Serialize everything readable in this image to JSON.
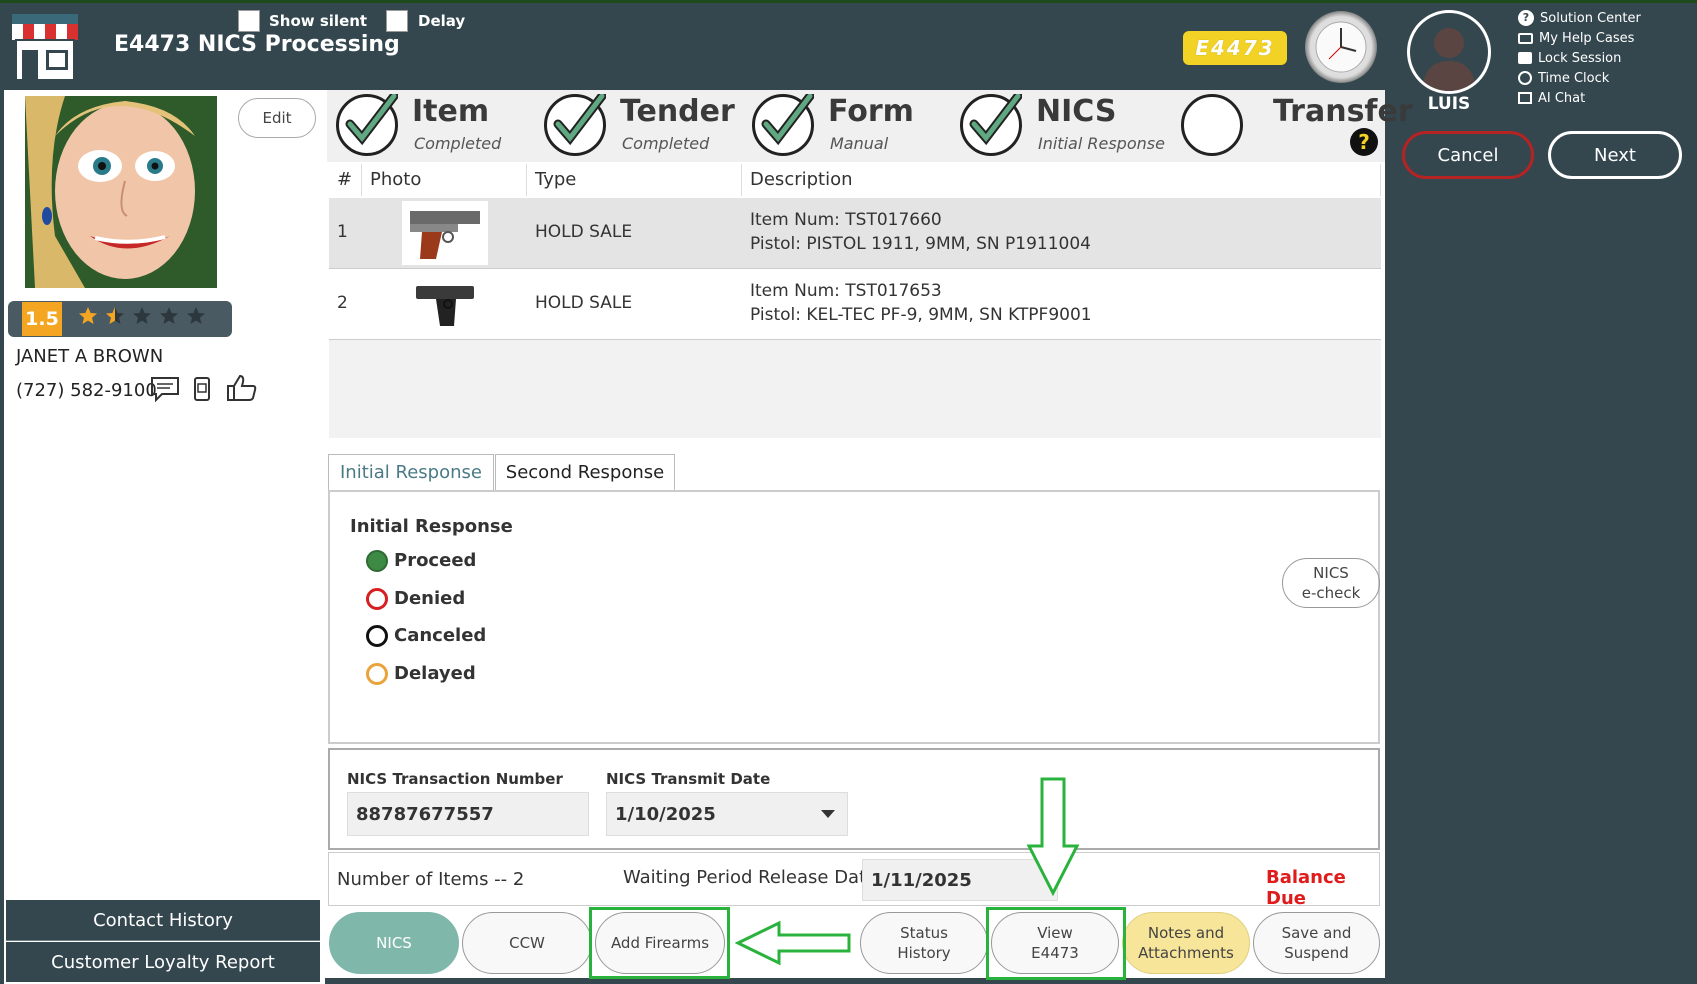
{
  "header": {
    "title": "E4473 NICS Processing",
    "show_silent_label": "Show silent",
    "delay_label": "Delay",
    "badge": "E4473"
  },
  "user": {
    "name": "LUIS",
    "menu": [
      "Solution Center",
      "My Help Cases",
      "Lock Session",
      "Time Clock",
      "AI Chat"
    ],
    "cancel_label": "Cancel",
    "next_label": "Next"
  },
  "steps": [
    {
      "title": "Item",
      "sub": "Completed",
      "done": true
    },
    {
      "title": "Tender",
      "sub": "Completed",
      "done": true
    },
    {
      "title": "Form",
      "sub": "Manual",
      "done": true
    },
    {
      "title": "NICS",
      "sub": "Initial Response",
      "done": true
    },
    {
      "title": "Transfer",
      "sub": "",
      "done": false
    }
  ],
  "table": {
    "headers": [
      "#",
      "Photo",
      "Type",
      "Description"
    ],
    "rows": [
      {
        "num": "1",
        "type": "HOLD SALE",
        "desc1": "Item Num: TST017660",
        "desc2": "Pistol: PISTOL 1911, 9MM, SN P1911004"
      },
      {
        "num": "2",
        "type": "HOLD SALE",
        "desc1": "Item Num: TST017653",
        "desc2": "Pistol: KEL-TEC PF-9, 9MM, SN KTPF9001"
      }
    ]
  },
  "tabs": [
    "Initial Response",
    "Second Response"
  ],
  "response": {
    "heading": "Initial Response",
    "options": [
      "Proceed",
      "Denied",
      "Canceled",
      "Delayed"
    ],
    "selected": "Proceed",
    "echeck_line1": "NICS",
    "echeck_line2": "e-check"
  },
  "nics": {
    "txn_label": "NICS Transaction Number",
    "txn_value": "88787677557",
    "date_label": "NICS Transmit Date",
    "date_value": "1/10/2025"
  },
  "info": {
    "items": "Number of Items -- 2",
    "waiting_label": "Waiting Period Release Date:",
    "waiting_value": "1/11/2025",
    "balance": "Balance Due"
  },
  "bottom_buttons": [
    {
      "l1": "NICS",
      "l2": ""
    },
    {
      "l1": "CCW",
      "l2": ""
    },
    {
      "l1": "Add Firearms",
      "l2": ""
    },
    {
      "l1": "Status",
      "l2": "History"
    },
    {
      "l1": "View",
      "l2": "E4473"
    },
    {
      "l1": "Notes and",
      "l2": "Attachments"
    },
    {
      "l1": "Save and",
      "l2": "Suspend"
    }
  ],
  "customer": {
    "edit_label": "Edit",
    "rating": "1.5",
    "rating_value": 1.5,
    "rating_max": 5,
    "name": "JANET A BROWN",
    "phone": "(727) 582-9100"
  },
  "left_buttons": [
    "Contact History",
    "Customer Loyalty Report"
  ],
  "colors": {
    "dark": "#34474f",
    "accent_green": "#2ab33c",
    "nics_btn": "#7fb8aa",
    "notes_btn": "#f7e59a",
    "balance": "#e01b1b"
  }
}
